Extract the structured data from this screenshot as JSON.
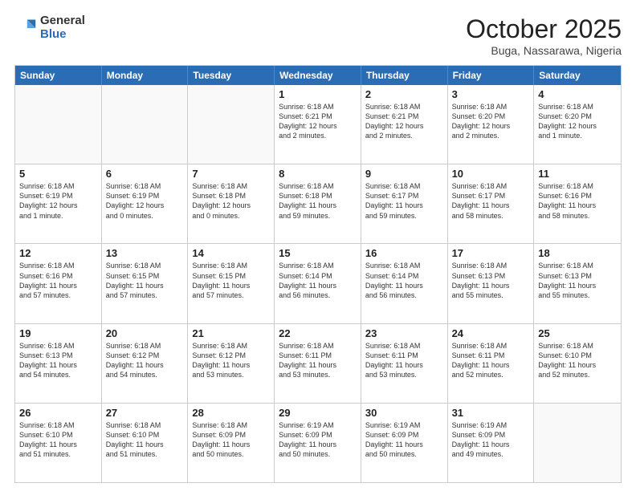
{
  "logo": {
    "general": "General",
    "blue": "Blue"
  },
  "header": {
    "month": "October 2025",
    "location": "Buga, Nassarawa, Nigeria"
  },
  "weekdays": [
    "Sunday",
    "Monday",
    "Tuesday",
    "Wednesday",
    "Thursday",
    "Friday",
    "Saturday"
  ],
  "rows": [
    [
      {
        "day": "",
        "info": ""
      },
      {
        "day": "",
        "info": ""
      },
      {
        "day": "",
        "info": ""
      },
      {
        "day": "1",
        "lines": [
          "Sunrise: 6:18 AM",
          "Sunset: 6:21 PM",
          "Daylight: 12 hours",
          "and 2 minutes."
        ]
      },
      {
        "day": "2",
        "lines": [
          "Sunrise: 6:18 AM",
          "Sunset: 6:21 PM",
          "Daylight: 12 hours",
          "and 2 minutes."
        ]
      },
      {
        "day": "3",
        "lines": [
          "Sunrise: 6:18 AM",
          "Sunset: 6:20 PM",
          "Daylight: 12 hours",
          "and 2 minutes."
        ]
      },
      {
        "day": "4",
        "lines": [
          "Sunrise: 6:18 AM",
          "Sunset: 6:20 PM",
          "Daylight: 12 hours",
          "and 1 minute."
        ]
      }
    ],
    [
      {
        "day": "5",
        "lines": [
          "Sunrise: 6:18 AM",
          "Sunset: 6:19 PM",
          "Daylight: 12 hours",
          "and 1 minute."
        ]
      },
      {
        "day": "6",
        "lines": [
          "Sunrise: 6:18 AM",
          "Sunset: 6:19 PM",
          "Daylight: 12 hours",
          "and 0 minutes."
        ]
      },
      {
        "day": "7",
        "lines": [
          "Sunrise: 6:18 AM",
          "Sunset: 6:18 PM",
          "Daylight: 12 hours",
          "and 0 minutes."
        ]
      },
      {
        "day": "8",
        "lines": [
          "Sunrise: 6:18 AM",
          "Sunset: 6:18 PM",
          "Daylight: 11 hours",
          "and 59 minutes."
        ]
      },
      {
        "day": "9",
        "lines": [
          "Sunrise: 6:18 AM",
          "Sunset: 6:17 PM",
          "Daylight: 11 hours",
          "and 59 minutes."
        ]
      },
      {
        "day": "10",
        "lines": [
          "Sunrise: 6:18 AM",
          "Sunset: 6:17 PM",
          "Daylight: 11 hours",
          "and 58 minutes."
        ]
      },
      {
        "day": "11",
        "lines": [
          "Sunrise: 6:18 AM",
          "Sunset: 6:16 PM",
          "Daylight: 11 hours",
          "and 58 minutes."
        ]
      }
    ],
    [
      {
        "day": "12",
        "lines": [
          "Sunrise: 6:18 AM",
          "Sunset: 6:16 PM",
          "Daylight: 11 hours",
          "and 57 minutes."
        ]
      },
      {
        "day": "13",
        "lines": [
          "Sunrise: 6:18 AM",
          "Sunset: 6:15 PM",
          "Daylight: 11 hours",
          "and 57 minutes."
        ]
      },
      {
        "day": "14",
        "lines": [
          "Sunrise: 6:18 AM",
          "Sunset: 6:15 PM",
          "Daylight: 11 hours",
          "and 57 minutes."
        ]
      },
      {
        "day": "15",
        "lines": [
          "Sunrise: 6:18 AM",
          "Sunset: 6:14 PM",
          "Daylight: 11 hours",
          "and 56 minutes."
        ]
      },
      {
        "day": "16",
        "lines": [
          "Sunrise: 6:18 AM",
          "Sunset: 6:14 PM",
          "Daylight: 11 hours",
          "and 56 minutes."
        ]
      },
      {
        "day": "17",
        "lines": [
          "Sunrise: 6:18 AM",
          "Sunset: 6:13 PM",
          "Daylight: 11 hours",
          "and 55 minutes."
        ]
      },
      {
        "day": "18",
        "lines": [
          "Sunrise: 6:18 AM",
          "Sunset: 6:13 PM",
          "Daylight: 11 hours",
          "and 55 minutes."
        ]
      }
    ],
    [
      {
        "day": "19",
        "lines": [
          "Sunrise: 6:18 AM",
          "Sunset: 6:13 PM",
          "Daylight: 11 hours",
          "and 54 minutes."
        ]
      },
      {
        "day": "20",
        "lines": [
          "Sunrise: 6:18 AM",
          "Sunset: 6:12 PM",
          "Daylight: 11 hours",
          "and 54 minutes."
        ]
      },
      {
        "day": "21",
        "lines": [
          "Sunrise: 6:18 AM",
          "Sunset: 6:12 PM",
          "Daylight: 11 hours",
          "and 53 minutes."
        ]
      },
      {
        "day": "22",
        "lines": [
          "Sunrise: 6:18 AM",
          "Sunset: 6:11 PM",
          "Daylight: 11 hours",
          "and 53 minutes."
        ]
      },
      {
        "day": "23",
        "lines": [
          "Sunrise: 6:18 AM",
          "Sunset: 6:11 PM",
          "Daylight: 11 hours",
          "and 53 minutes."
        ]
      },
      {
        "day": "24",
        "lines": [
          "Sunrise: 6:18 AM",
          "Sunset: 6:11 PM",
          "Daylight: 11 hours",
          "and 52 minutes."
        ]
      },
      {
        "day": "25",
        "lines": [
          "Sunrise: 6:18 AM",
          "Sunset: 6:10 PM",
          "Daylight: 11 hours",
          "and 52 minutes."
        ]
      }
    ],
    [
      {
        "day": "26",
        "lines": [
          "Sunrise: 6:18 AM",
          "Sunset: 6:10 PM",
          "Daylight: 11 hours",
          "and 51 minutes."
        ]
      },
      {
        "day": "27",
        "lines": [
          "Sunrise: 6:18 AM",
          "Sunset: 6:10 PM",
          "Daylight: 11 hours",
          "and 51 minutes."
        ]
      },
      {
        "day": "28",
        "lines": [
          "Sunrise: 6:18 AM",
          "Sunset: 6:09 PM",
          "Daylight: 11 hours",
          "and 50 minutes."
        ]
      },
      {
        "day": "29",
        "lines": [
          "Sunrise: 6:19 AM",
          "Sunset: 6:09 PM",
          "Daylight: 11 hours",
          "and 50 minutes."
        ]
      },
      {
        "day": "30",
        "lines": [
          "Sunrise: 6:19 AM",
          "Sunset: 6:09 PM",
          "Daylight: 11 hours",
          "and 50 minutes."
        ]
      },
      {
        "day": "31",
        "lines": [
          "Sunrise: 6:19 AM",
          "Sunset: 6:09 PM",
          "Daylight: 11 hours",
          "and 49 minutes."
        ]
      },
      {
        "day": "",
        "info": ""
      }
    ]
  ]
}
